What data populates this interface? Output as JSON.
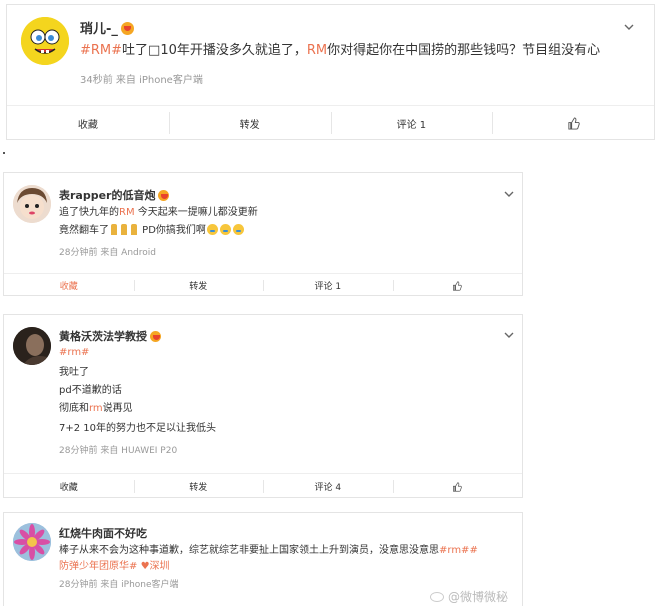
{
  "colors": {
    "accent": "#eb7350",
    "muted": "#999999",
    "border": "#e4e4e4"
  },
  "main_post": {
    "username": "琑儿-_",
    "text_parts": [
      "#RM#",
      "吐了□10年开播没多久就追了，",
      "RM",
      "你对得起你在中国捞的那些钱吗？节目组没有心"
    ],
    "meta": "34秒前  来自 iPhone客户端",
    "actions": {
      "collect": "收藏",
      "repost": "转发",
      "comment": "评论 1",
      "like_icon": "thumbs-up-icon"
    }
  },
  "comments": [
    {
      "username": "表rapper的低音炮",
      "lines": [
        [
          "追了快九年的",
          "RM",
          " 今天起来一提嘛儿都没更新"
        ],
        [
          "竟然翻车了",
          "",
          " PD你搞我们啊"
        ]
      ],
      "meta": "28分钟前  来自 Android",
      "actions": {
        "collect": "收藏",
        "repost": "转发",
        "comment": "评论 1"
      }
    },
    {
      "username": "黄格沃茨法学教授",
      "lines": [
        [
          "#rm#"
        ],
        [
          "我吐了"
        ],
        [
          "pd不道歉的话"
        ],
        [
          "彻底和",
          "rm",
          "说再见"
        ],
        [
          "7+2 10年的努力也不足以让我低头"
        ]
      ],
      "meta": "28分钟前  来自 HUAWEI P20",
      "actions": {
        "collect": "收藏",
        "repost": "转发",
        "comment": "评论 4"
      }
    },
    {
      "username": "红烧牛肉面不好吃",
      "lines": [
        [
          "棒子从来不会为这种事道歉，综艺就综艺非要扯上国家领土上升到演员，没意思没意思",
          "#rm#",
          "#"
        ],
        [
          "防弹少年团原华#",
          " ♥深圳"
        ]
      ],
      "meta": "28分钟前  来自 iPhone客户端"
    }
  ],
  "watermark": "@微博微秘"
}
